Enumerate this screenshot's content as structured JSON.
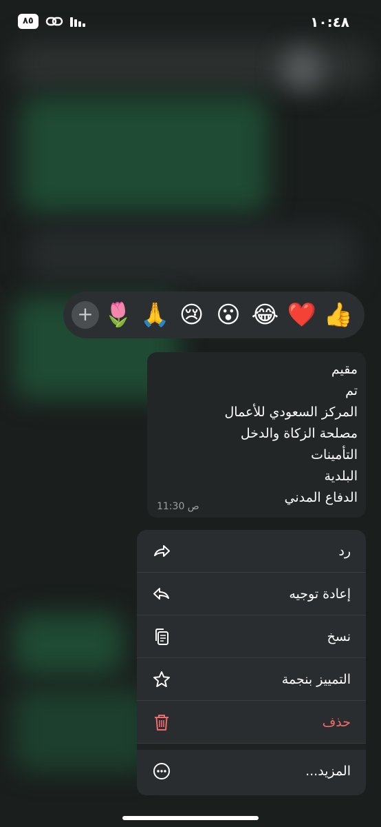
{
  "status_bar": {
    "time": "١٠:٤٨",
    "battery": "٨٥"
  },
  "reactions": {
    "emojis": [
      "👍",
      "❤️",
      "😂",
      "😮",
      "😢",
      "🙏",
      "🌷"
    ],
    "more_label": "+"
  },
  "message": {
    "lines": [
      "مقيم",
      "تم",
      "المركز السعودي للأعمال",
      "مصلحة الزكاة والدخل",
      "التأمينات",
      "البلدية",
      "الدفاع المدني"
    ],
    "time": "11:30 ص"
  },
  "menu": {
    "reply": "رد",
    "forward": "إعادة توجيه",
    "copy": "نسخ",
    "star": "التمييز بنجمة",
    "delete": "حذف",
    "more": "المزيد..."
  },
  "colors": {
    "danger": "#f26b6b",
    "menu_bg": "#2a2d2f",
    "bubble_bg": "#232627"
  }
}
